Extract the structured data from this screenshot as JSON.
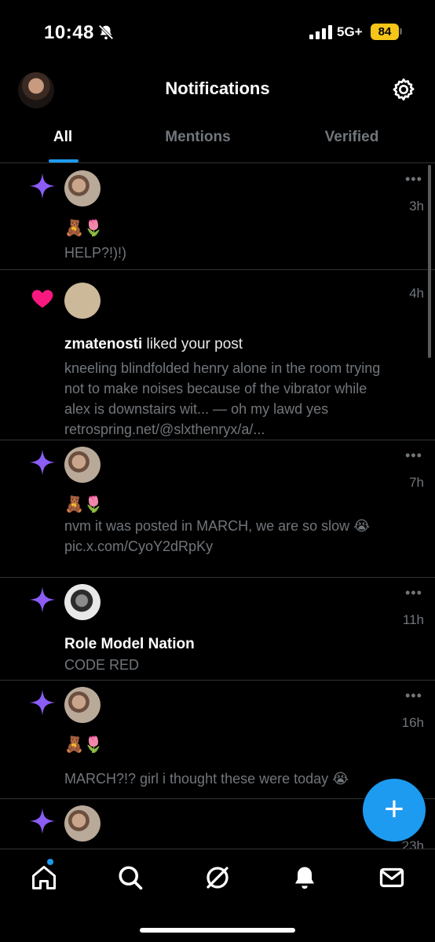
{
  "status_bar": {
    "time": "10:48",
    "network": "5G+",
    "battery": "84",
    "icons": [
      "bell-slash-icon",
      "signal-icon",
      "battery-icon"
    ]
  },
  "header": {
    "title": "Notifications",
    "icons": [
      "profile-avatar",
      "gear-icon"
    ]
  },
  "tabs": [
    {
      "label": "All",
      "active": true
    },
    {
      "label": "Mentions",
      "active": false
    },
    {
      "label": "Verified",
      "active": false
    }
  ],
  "notifications": [
    {
      "type": "post",
      "icon": "sparkle-icon",
      "time": "3h",
      "emoji": "🧸🌷",
      "text": "HELP?!)!)"
    },
    {
      "type": "like",
      "icon": "heart-icon",
      "time": "4h",
      "user": "zmatenosti",
      "action": " liked your post",
      "lines": [
        "kneeling blindfolded henry alone in the room trying",
        "not to make noises because of the vibrator while",
        "alex is downstairs wit... — oh my lawd yes",
        "retrospring.net/@slxthenryx/a/..."
      ]
    },
    {
      "type": "post",
      "icon": "sparkle-icon",
      "time": "7h",
      "emoji": "🧸🌷",
      "lines": [
        "nvm it was posted in MARCH, we are so slow 😭",
        "pic.x.com/CyoY2dRpKy"
      ]
    },
    {
      "type": "post",
      "icon": "sparkle-icon",
      "time": "11h",
      "user": "Role Model Nation",
      "text": "CODE RED"
    },
    {
      "type": "post",
      "icon": "sparkle-icon",
      "time": "16h",
      "emoji": "🧸🌷",
      "text": "MARCH?!? girl i thought these were today 😭"
    },
    {
      "type": "post",
      "icon": "sparkle-icon",
      "time": "23h"
    }
  ],
  "fab": {
    "label": "+"
  },
  "bottom_nav": [
    "home-icon",
    "search-icon",
    "grok-icon",
    "bell-icon",
    "mail-icon"
  ],
  "colors": {
    "accent": "#1d9bf0",
    "sparkle": "#8b5cf6",
    "heart": "#f91880",
    "battery": "#f5c518"
  }
}
